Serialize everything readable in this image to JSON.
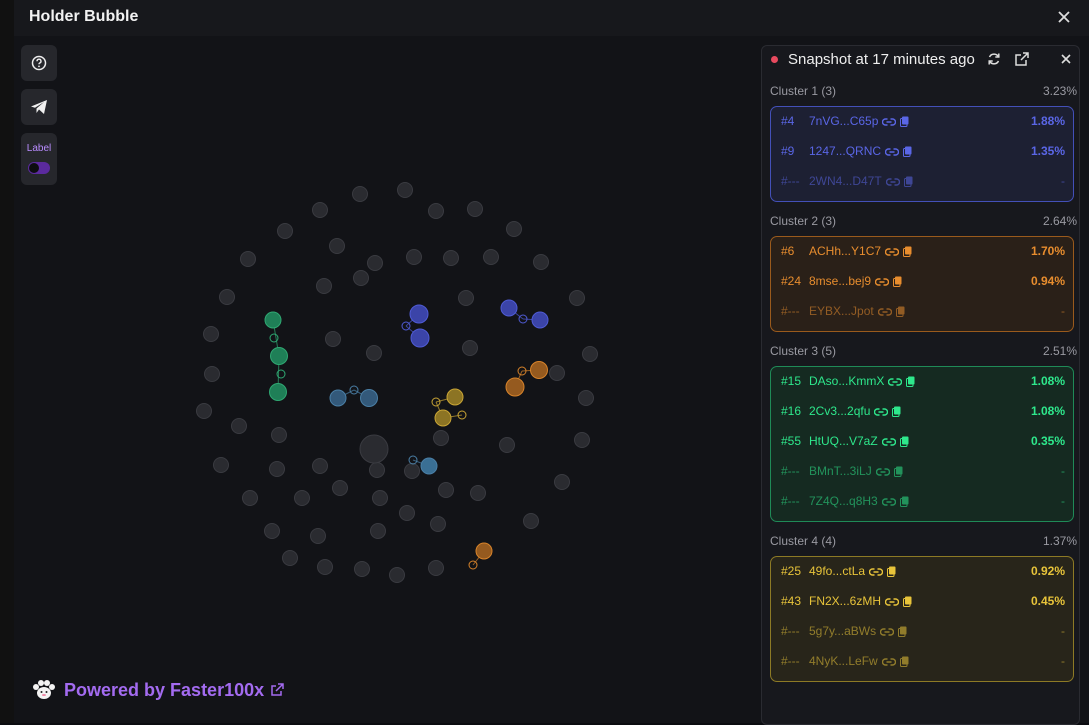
{
  "window": {
    "title": "Holder Bubble"
  },
  "toolbar": {
    "label_text": "Label"
  },
  "footer": {
    "powered_by": "Powered by",
    "brand": "Faster100x"
  },
  "panel": {
    "snapshot_text": "Snapshot at 17 minutes ago"
  },
  "colors": {
    "blue": "#4f5bd5",
    "orange": "#e08a2c",
    "green": "#2fd48a",
    "yellow": "#e0c040",
    "steel": "#4a7fa6",
    "purple": "#a36bf0"
  },
  "clusters": [
    {
      "name": "Cluster 1 (3)",
      "pct": "3.23%",
      "color": "#5a66e6",
      "bg": "#1d2033",
      "border": "#4350b8",
      "rows": [
        {
          "rank": "#4",
          "addr": "7nVG...C65p",
          "val": "1.88%"
        },
        {
          "rank": "#9",
          "addr": "1247...QRNC",
          "val": "1.35%"
        },
        {
          "rank": "#---",
          "addr": "2WN4...D47T",
          "val": "-"
        }
      ]
    },
    {
      "name": "Cluster 2 (3)",
      "pct": "2.64%",
      "color": "#e88d2e",
      "bg": "#2a2018",
      "border": "#9a5a1c",
      "rows": [
        {
          "rank": "#6",
          "addr": "ACHh...Y1C7",
          "val": "1.70%"
        },
        {
          "rank": "#24",
          "addr": "8mse...bej9",
          "val": "0.94%"
        },
        {
          "rank": "#---",
          "addr": "EYBX...Jpot",
          "val": "-"
        }
      ]
    },
    {
      "name": "Cluster 3 (5)",
      "pct": "2.51%",
      "color": "#2ee88c",
      "bg": "#152a21",
      "border": "#1f8a57",
      "rows": [
        {
          "rank": "#15",
          "addr": "DAso...KmmX",
          "val": "1.08%"
        },
        {
          "rank": "#16",
          "addr": "2Cv3...2qfu",
          "val": "1.08%"
        },
        {
          "rank": "#55",
          "addr": "HtUQ...V7aZ",
          "val": "0.35%"
        },
        {
          "rank": "#---",
          "addr": "BMnT...3iLJ",
          "val": "-"
        },
        {
          "rank": "#---",
          "addr": "7Z4Q...q8H3",
          "val": "-"
        }
      ]
    },
    {
      "name": "Cluster 4 (4)",
      "pct": "1.37%",
      "color": "#e8c43a",
      "bg": "#28251a",
      "border": "#8d7a25",
      "rows": [
        {
          "rank": "#25",
          "addr": "49fo...ctLa",
          "val": "0.92%"
        },
        {
          "rank": "#43",
          "addr": "FN2X...6zMH",
          "val": "0.45%"
        },
        {
          "rank": "#---",
          "addr": "5g7y...aBWs",
          "val": "-"
        },
        {
          "rank": "#---",
          "addr": "4NyK...LeFw",
          "val": "-"
        }
      ]
    }
  ]
}
